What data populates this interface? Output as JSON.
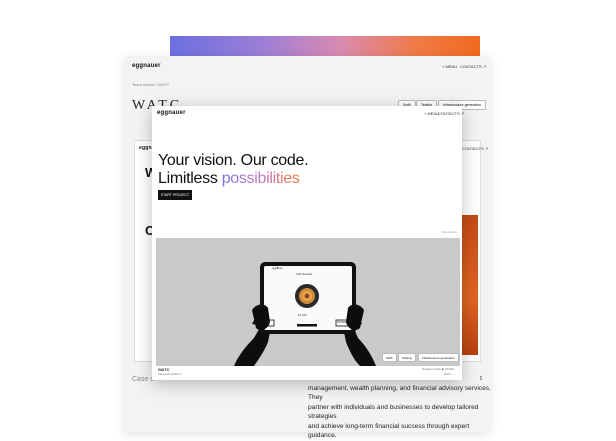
{
  "back_page": {
    "logo": "eggnauer",
    "nav": {
      "menu": "+ MENU",
      "contacts": "CONTACTS ↗"
    },
    "breadcrumb": "Team stories  /  WATC",
    "title": "WATC",
    "pills": [
      "Swift",
      "Testing",
      "Infrastructure generation"
    ],
    "inner_logo": "eggnauer",
    "inner_nav": "CONTACTS ↗",
    "letter_w": "W",
    "letter_c": "C",
    "case_label": "Case o",
    "bottom_paragraph": {
      "line1": "t",
      "line2": "management, wealth planning, and financial advisory services. They",
      "line3": "partner with individuals and businesses to develop tailored strategies",
      "line4": "and achieve long-term financial success through expert guidance."
    }
  },
  "front_card": {
    "logo": "eggnauer",
    "nav": {
      "menu": "+ MENU",
      "contacts": "CONTACTS ↗"
    },
    "hero": {
      "line1": "Your vision. Our code.",
      "line2_plain": "Limitless ",
      "line2_gradient": "possibilities"
    },
    "cta": "START PROJECT",
    "scroll_hint": "Scroll down",
    "tablet": {
      "header_left": "eggnauer",
      "header_center": "●",
      "subtitle": "Gold Standard",
      "price": "$ 1,340",
      "button": "BUY NOW",
      "left_badge": "PS",
      "right_badge": "PROMA"
    },
    "tags": [
      "Swift",
      "Testing",
      "Infrastructure generation"
    ],
    "footer_left_title": "WATC",
    "footer_left_sub": "Financial platform",
    "footer_right_1": "Designed with ◆ FIGMA",
    "footer_right_2": "2024"
  },
  "colors": {
    "gradient_start": "#6b6fe0",
    "gradient_end": "#f06a1e",
    "accent_orange": "#e06522"
  },
  "icons": [
    "arrow-up-right-icon",
    "flower-icon"
  ]
}
